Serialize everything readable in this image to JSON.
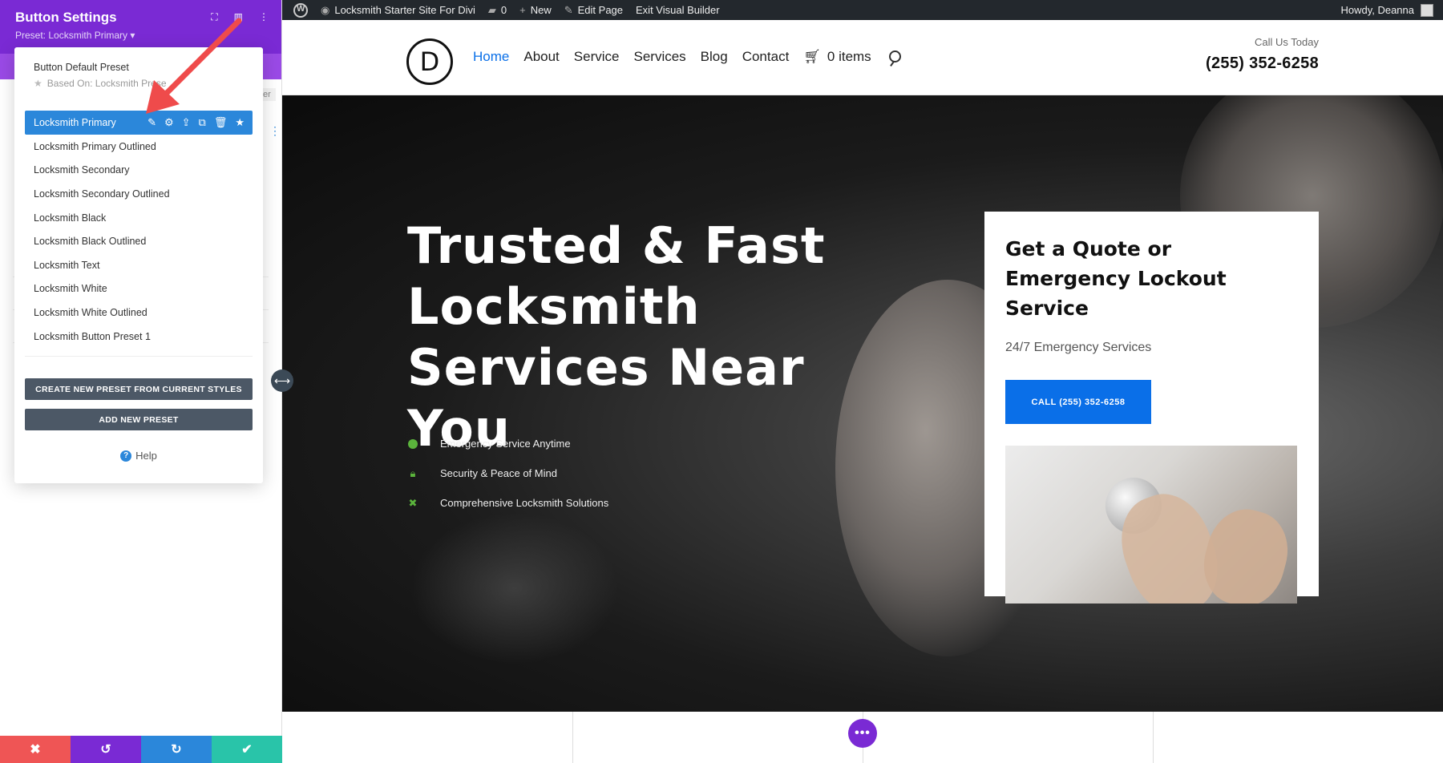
{
  "adminbar": {
    "site_name": "Locksmith Starter Site For Divi",
    "comments_count": "0",
    "new_label": "New",
    "edit_page": "Edit Page",
    "exit_builder": "Exit Visual Builder",
    "howdy": "Howdy, Deanna"
  },
  "header": {
    "logo_letter": "D",
    "nav": [
      "Home",
      "About",
      "Service",
      "Services",
      "Blog",
      "Contact"
    ],
    "cart_label": "0 items",
    "call_label": "Call Us Today",
    "phone": "(255) 352-6258"
  },
  "hero": {
    "title": "Trusted & Fast Locksmith Services Near You",
    "features": [
      {
        "icon": "clock-icon",
        "label": "Emergency Service Anytime"
      },
      {
        "icon": "lock-icon",
        "label": "Security & Peace of Mind"
      },
      {
        "icon": "tools-icon",
        "label": "Comprehensive Locksmith Solutions"
      }
    ],
    "card": {
      "title": "Get a Quote or Emergency Lockout Service",
      "subtitle": "24/7 Emergency Services",
      "button": "CALL (255) 352-6258"
    }
  },
  "panel": {
    "title": "Button Settings",
    "preset_label": "Preset: Locksmith Primary ▾",
    "ghost_tab": "er"
  },
  "presets": {
    "default_label": "Button Default Preset",
    "based_on": "Based On: Locksmith Prese",
    "items": [
      "Locksmith Primary",
      "Locksmith Primary Outlined",
      "Locksmith Secondary",
      "Locksmith Secondary Outlined",
      "Locksmith Black",
      "Locksmith Black Outlined",
      "Locksmith Text",
      "Locksmith White",
      "Locksmith White Outlined",
      "Locksmith Button Preset 1"
    ],
    "active_index": 0,
    "create_button": "CREATE NEW PRESET FROM CURRENT STYLES",
    "add_button": "ADD NEW PRESET",
    "help": "Help"
  },
  "colors": {
    "divi_purple": "#7a2ad4",
    "active_blue": "#2b87da",
    "accent_blue": "#0a6fe8",
    "feature_green": "#5bb43c",
    "arrow_red": "#ef4b4b"
  }
}
